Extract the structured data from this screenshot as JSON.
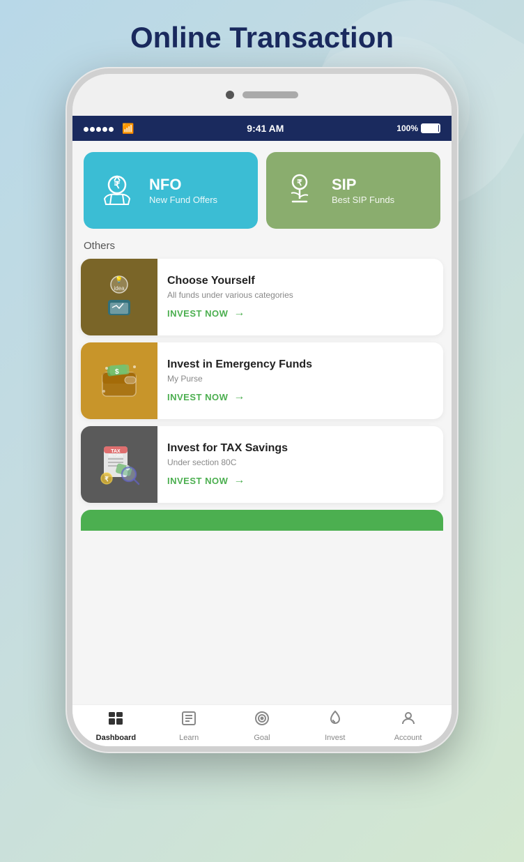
{
  "page": {
    "title": "Online Transaction",
    "background": {
      "gradient_start": "#b8d8e8",
      "gradient_end": "#d4e8d0"
    }
  },
  "status_bar": {
    "time": "9:41 AM",
    "battery": "100%"
  },
  "cards": {
    "nfo": {
      "title": "NFO",
      "subtitle": "New Fund Offers",
      "bg_color": "#3bbdd4"
    },
    "sip": {
      "title": "SIP",
      "subtitle": "Best SIP Funds",
      "bg_color": "#8aad6e"
    }
  },
  "others": {
    "label": "Others",
    "items": [
      {
        "id": "choose-yourself",
        "title": "Choose Yourself",
        "description": "All funds under various categories",
        "cta": "INVEST NOW",
        "bg_color": "#7a6528"
      },
      {
        "id": "emergency-funds",
        "title": "Invest in Emergency Funds",
        "description": "My Purse",
        "cta": "INVEST NOW",
        "bg_color": "#c8952a"
      },
      {
        "id": "tax-savings",
        "title": "Invest for TAX Savings",
        "description": "Under section 80C",
        "cta": "INVEST NOW",
        "bg_color": "#5a5a5a"
      }
    ]
  },
  "bottom_nav": {
    "items": [
      {
        "id": "dashboard",
        "label": "Dashboard",
        "active": true
      },
      {
        "id": "learn",
        "label": "Learn",
        "active": false
      },
      {
        "id": "goal",
        "label": "Goal",
        "active": false
      },
      {
        "id": "invest",
        "label": "Invest",
        "active": false
      },
      {
        "id": "account",
        "label": "Account",
        "active": false
      }
    ]
  }
}
